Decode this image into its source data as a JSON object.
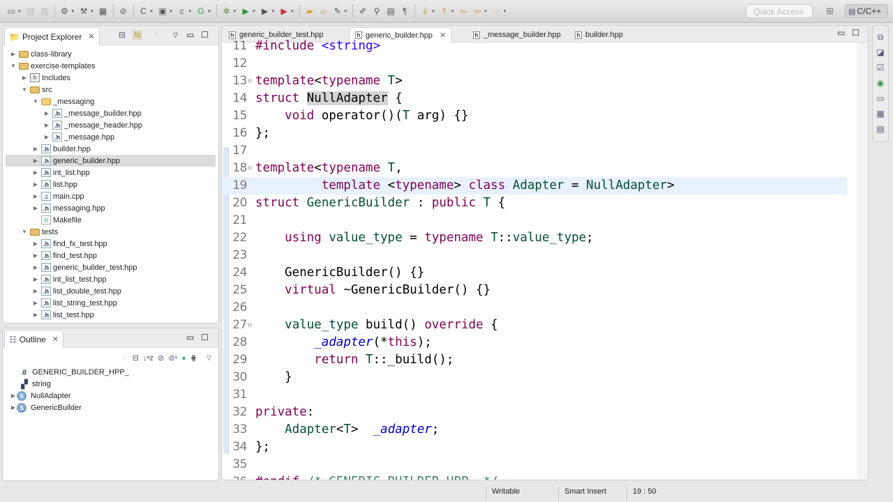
{
  "toolbar": {
    "quick_access_placeholder": "Quick Access",
    "perspective_label": "C/C++",
    "icons": [
      "new-icon",
      "save-icon",
      "save-all-icon",
      "build-config-icon",
      "hammer-icon",
      "binary-icon",
      "no-skip-icon",
      "new-class-icon",
      "new-folder-icon",
      "new-file-icon",
      "new-project-icon",
      "debug-icon",
      "run-icon",
      "run-tools-icon",
      "external-tools-icon",
      "open-type-icon",
      "open-folder-icon",
      "brush-icon",
      "highlight-icon",
      "search-icon",
      "toggle-block-icon",
      "show-whitespace-icon",
      "next-annotation-icon",
      "prev-annotation-icon",
      "last-edit-icon",
      "back-icon",
      "forward-icon"
    ]
  },
  "project_explorer": {
    "title": "Project Explorer",
    "items": [
      {
        "label": "class-library",
        "type": "project",
        "depth": 0,
        "expanded": false
      },
      {
        "label": "exercise-templates",
        "type": "project",
        "depth": 0,
        "expanded": true
      },
      {
        "label": "Includes",
        "type": "includes",
        "depth": 1,
        "expanded": false
      },
      {
        "label": "src",
        "type": "srcfolder",
        "depth": 1,
        "expanded": true
      },
      {
        "label": "_messaging",
        "type": "folder",
        "depth": 2,
        "expanded": true
      },
      {
        "label": "_message_builder.hpp",
        "type": "h",
        "depth": 3,
        "expanded": false
      },
      {
        "label": "_message_header.hpp",
        "type": "h",
        "depth": 3,
        "expanded": false
      },
      {
        "label": "_message.hpp",
        "type": "h",
        "depth": 3,
        "expanded": false
      },
      {
        "label": "builder.hpp",
        "type": "h",
        "depth": 2,
        "expanded": false
      },
      {
        "label": "generic_builder.hpp",
        "type": "h",
        "depth": 2,
        "expanded": false,
        "selected": true
      },
      {
        "label": "int_list.hpp",
        "type": "h",
        "depth": 2,
        "expanded": false
      },
      {
        "label": "list.hpp",
        "type": "h",
        "depth": 2,
        "expanded": false
      },
      {
        "label": "main.cpp",
        "type": "c",
        "depth": 2,
        "expanded": false
      },
      {
        "label": "messaging.hpp",
        "type": "h",
        "depth": 2,
        "expanded": false
      },
      {
        "label": "Makefile",
        "type": "make",
        "depth": 2
      },
      {
        "label": "tests",
        "type": "srcfolder",
        "depth": 1,
        "expanded": true
      },
      {
        "label": "find_fx_test.hpp",
        "type": "h",
        "depth": 2,
        "expanded": false
      },
      {
        "label": "find_test.hpp",
        "type": "h",
        "depth": 2,
        "expanded": false
      },
      {
        "label": "generic_builder_test.hpp",
        "type": "h",
        "depth": 2,
        "expanded": false
      },
      {
        "label": "int_list_test.hpp",
        "type": "h",
        "depth": 2,
        "expanded": false
      },
      {
        "label": "list_double_test.hpp",
        "type": "h",
        "depth": 2,
        "expanded": false
      },
      {
        "label": "list_string_test.hpp",
        "type": "h",
        "depth": 2,
        "expanded": false
      },
      {
        "label": "list_test.hpp",
        "type": "h",
        "depth": 2,
        "expanded": false
      }
    ]
  },
  "outline": {
    "title": "Outline",
    "items": [
      {
        "label": "GENERIC_BUILDER_HPP_",
        "type": "macro"
      },
      {
        "label": "string",
        "type": "include"
      },
      {
        "label": "NullAdapter",
        "type": "struct"
      },
      {
        "label": "GenericBuilder",
        "type": "struct"
      }
    ]
  },
  "editor": {
    "tabs": [
      {
        "label": "generic_builder_test.hpp",
        "active": false
      },
      {
        "label": "generic_builder.hpp",
        "active": true
      },
      {
        "label": "_message_builder.hpp",
        "active": false
      },
      {
        "label": "builder.hpp",
        "active": false
      }
    ],
    "current_line": 19,
    "lines": [
      {
        "n": "11",
        "tokens": [
          [
            "mac",
            "#include "
          ],
          [
            "str",
            "<string>"
          ]
        ]
      },
      {
        "n": "12",
        "tokens": []
      },
      {
        "n": "13",
        "fold": true,
        "tokens": [
          [
            "kw",
            "template"
          ],
          [
            "",
            "<"
          ],
          [
            "kw",
            "typename"
          ],
          [
            "ty",
            " T"
          ],
          [
            "",
            ">"
          ]
        ]
      },
      {
        "n": "14",
        "tokens": [
          [
            "kw",
            "struct "
          ],
          [
            "hl",
            "NullAdapter"
          ],
          [
            "",
            " {"
          ]
        ]
      },
      {
        "n": "15",
        "tokens": [
          [
            "",
            "    "
          ],
          [
            "kw",
            "void"
          ],
          [
            "",
            " operator()("
          ],
          [
            "ty",
            "T"
          ],
          [
            "",
            " arg) {}"
          ]
        ]
      },
      {
        "n": "16",
        "tokens": [
          [
            "",
            "};"
          ]
        ]
      },
      {
        "n": "17",
        "tokens": []
      },
      {
        "n": "18",
        "fold": true,
        "tokens": [
          [
            "kw",
            "template"
          ],
          [
            "",
            "<"
          ],
          [
            "kw",
            "typename"
          ],
          [
            "ty",
            " T"
          ],
          [
            "",
            ","
          ]
        ]
      },
      {
        "n": "19",
        "tokens": [
          [
            "",
            "         "
          ],
          [
            "kw",
            "template"
          ],
          [
            "",
            " <"
          ],
          [
            "kw",
            "typename"
          ],
          [
            "",
            "> "
          ],
          [
            "kw",
            "class"
          ],
          [
            "ty",
            " Adapter"
          ],
          [
            "",
            " = "
          ],
          [
            "ty",
            "NullAdapter"
          ],
          [
            "",
            ">"
          ]
        ]
      },
      {
        "n": "20",
        "tokens": [
          [
            "kw",
            "struct "
          ],
          [
            "ty",
            "GenericBuilder"
          ],
          [
            "",
            " : "
          ],
          [
            "kw",
            "public"
          ],
          [
            "ty",
            " T"
          ],
          [
            "",
            " {"
          ]
        ]
      },
      {
        "n": "21",
        "tokens": []
      },
      {
        "n": "22",
        "tokens": [
          [
            "",
            "    "
          ],
          [
            "kw",
            "using"
          ],
          [
            "ty",
            " value_type"
          ],
          [
            "",
            " = "
          ],
          [
            "kw",
            "typename"
          ],
          [
            "ty",
            " T"
          ],
          [
            "",
            "::"
          ],
          [
            "ty",
            "value_type"
          ],
          [
            "",
            ";"
          ]
        ]
      },
      {
        "n": "23",
        "tokens": []
      },
      {
        "n": "24",
        "tokens": [
          [
            "",
            "    GenericBuilder() {}"
          ]
        ]
      },
      {
        "n": "25",
        "tokens": [
          [
            "",
            "    "
          ],
          [
            "kw",
            "virtual"
          ],
          [
            "",
            " ~GenericBuilder() {}"
          ]
        ]
      },
      {
        "n": "26",
        "tokens": []
      },
      {
        "n": "27",
        "fold": true,
        "tokens": [
          [
            "",
            "    "
          ],
          [
            "ty",
            "value_type"
          ],
          [
            "",
            " build() "
          ],
          [
            "kw",
            "override"
          ],
          [
            "",
            " {"
          ]
        ]
      },
      {
        "n": "28",
        "tokens": [
          [
            "",
            "        "
          ],
          [
            "fld",
            "_adapter"
          ],
          [
            "",
            "(*"
          ],
          [
            "kw",
            "this"
          ],
          [
            "",
            ");"
          ]
        ]
      },
      {
        "n": "29",
        "tokens": [
          [
            "",
            "        "
          ],
          [
            "kw",
            "return"
          ],
          [
            "ty",
            " T"
          ],
          [
            "",
            "::_build();"
          ]
        ]
      },
      {
        "n": "30",
        "tokens": [
          [
            "",
            "    }"
          ]
        ]
      },
      {
        "n": "31",
        "tokens": []
      },
      {
        "n": "32",
        "tokens": [
          [
            "kw",
            "private"
          ],
          [
            "",
            ":"
          ]
        ]
      },
      {
        "n": "33",
        "tokens": [
          [
            "",
            "    "
          ],
          [
            "ty",
            "Adapter"
          ],
          [
            "",
            "<"
          ],
          [
            "ty",
            "T"
          ],
          [
            "",
            ">  "
          ],
          [
            "fld",
            "_adapter"
          ],
          [
            "",
            ";"
          ]
        ]
      },
      {
        "n": "34",
        "tokens": [
          [
            "",
            "};"
          ]
        ]
      },
      {
        "n": "35",
        "tokens": []
      },
      {
        "n": "36",
        "tokens": [
          [
            "mac",
            "#endif"
          ],
          [
            "cm",
            " /* GENERIC_BUILDER_HPP_ */"
          ]
        ]
      }
    ]
  },
  "side_trim": [
    "restore-icon",
    "debug-view-icon",
    "tasks-icon",
    "target-icon",
    "console-icon",
    "table-icon",
    "properties-icon"
  ],
  "status": {
    "writable": "Writable",
    "insert_mode": "Smart Insert",
    "cursor_pos": "19 : 50"
  }
}
